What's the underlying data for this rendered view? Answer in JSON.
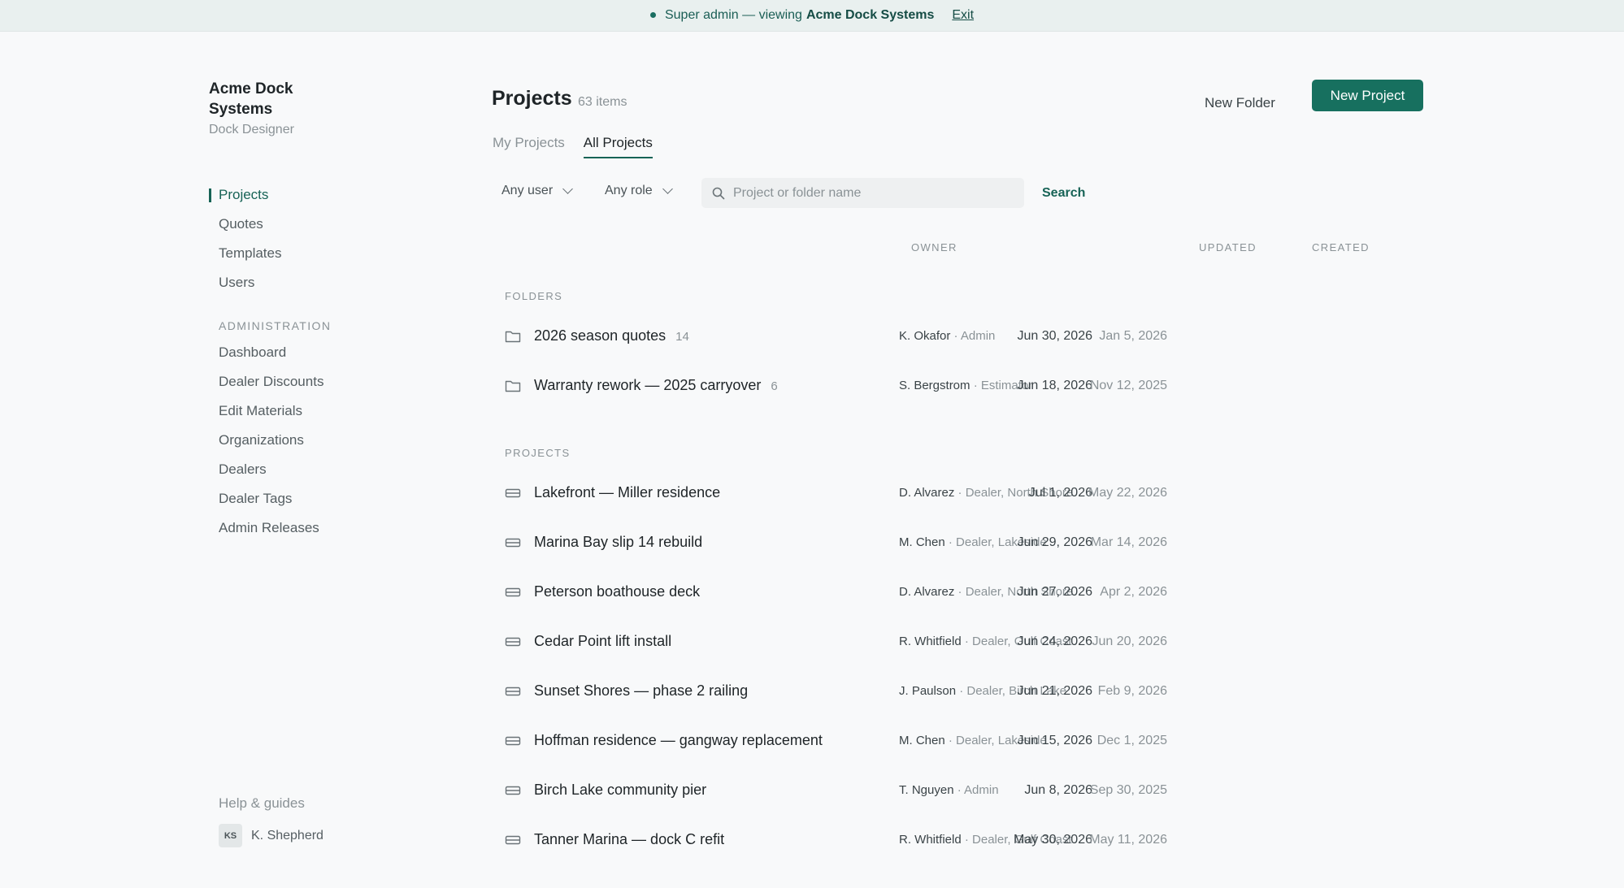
{
  "banner": {
    "text": "Super admin — viewing",
    "org": "Acme Dock Systems",
    "exit_label": "Exit"
  },
  "sidebar": {
    "brand_line1": "Acme Dock",
    "brand_line2": "Systems",
    "product": "Dock Designer",
    "nav": [
      "Projects",
      "Quotes",
      "Templates",
      "Users"
    ],
    "admin_section": "ADMINISTRATION",
    "admin_nav": [
      "Dashboard",
      "Dealer Discounts",
      "Edit Materials",
      "Organizations",
      "Dealers",
      "Dealer Tags",
      "Admin Releases"
    ],
    "help": "Help & guides",
    "user_initials": "KS",
    "user_name": "K. Shepherd"
  },
  "header": {
    "title": "Projects",
    "count": "63 items",
    "new_folder": "New Folder",
    "new_project": "New Project"
  },
  "tabs": [
    "My Projects",
    "All Projects"
  ],
  "filters": {
    "user": "Any user",
    "role": "Any role",
    "search_placeholder": "Project or folder name",
    "search_button": "Search"
  },
  "columns": {
    "owner": "OWNER",
    "updated": "UPDATED",
    "created": "CREATED"
  },
  "folders_label": "FOLDERS",
  "projects_label": "PROJECTS",
  "folders": [
    {
      "name": "2026 season quotes",
      "count": "14",
      "owner": "K. Okafor",
      "role": "· Admin",
      "updated": "Jun 30, 2026",
      "created": "Jan 5, 2026"
    },
    {
      "name": "Warranty rework — 2025 carryover",
      "count": "6",
      "owner": "S. Bergstrom",
      "role": "· Estimator",
      "updated": "Jun 18, 2026",
      "created": "Nov 12, 2025"
    }
  ],
  "projects": [
    {
      "name": "Lakefront — Miller residence",
      "owner": "D. Alvarez",
      "role": "· Dealer, North Shore",
      "updated": "Jul 1, 2026",
      "created": "May 22, 2026"
    },
    {
      "name": "Marina Bay slip 14 rebuild",
      "owner": "M. Chen",
      "role": "· Dealer, Lakeside",
      "updated": "Jun 29, 2026",
      "created": "Mar 14, 2026"
    },
    {
      "name": "Peterson boathouse deck",
      "owner": "D. Alvarez",
      "role": "· Dealer, North Shore",
      "updated": "Jun 27, 2026",
      "created": "Apr 2, 2026"
    },
    {
      "name": "Cedar Point lift install",
      "owner": "R. Whitfield",
      "role": "· Dealer, Gulf Coast",
      "updated": "Jun 24, 2026",
      "created": "Jun 20, 2026"
    },
    {
      "name": "Sunset Shores — phase 2 railing",
      "owner": "J. Paulson",
      "role": "· Dealer, Birch Lake",
      "updated": "Jun 21, 2026",
      "created": "Feb 9, 2026"
    },
    {
      "name": "Hoffman residence — gangway replacement",
      "owner": "M. Chen",
      "role": "· Dealer, Lakeside",
      "updated": "Jun 15, 2026",
      "created": "Dec 1, 2025"
    },
    {
      "name": "Birch Lake community pier",
      "owner": "T. Nguyen",
      "role": "· Admin",
      "updated": "Jun 8, 2026",
      "created": "Sep 30, 2025"
    },
    {
      "name": "Tanner Marina — dock C refit",
      "owner": "R. Whitfield",
      "role": "· Dealer, Gulf Coast",
      "updated": "May 30, 2026",
      "created": "May 11, 2026"
    }
  ]
}
